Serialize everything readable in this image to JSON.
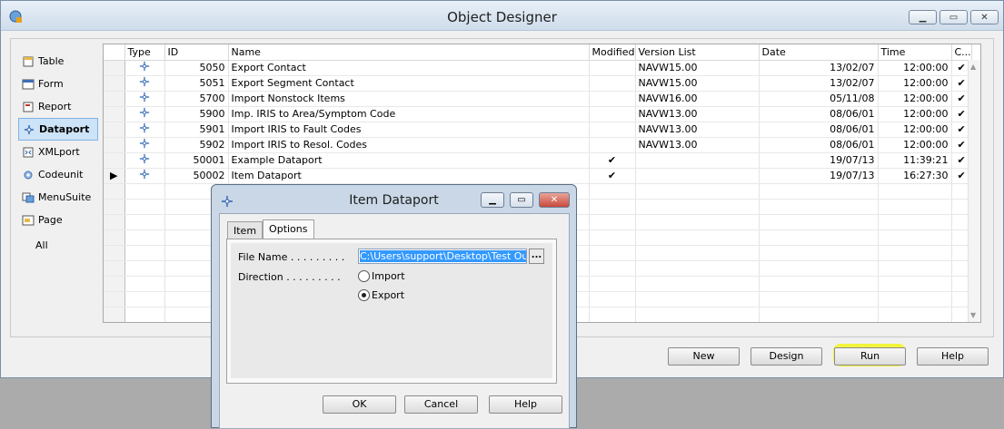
{
  "window": {
    "title": "Object Designer"
  },
  "nav": {
    "items": [
      {
        "label": "Table",
        "icon": "table-icon"
      },
      {
        "label": "Form",
        "icon": "form-icon"
      },
      {
        "label": "Report",
        "icon": "report-icon"
      },
      {
        "label": "Dataport",
        "icon": "dataport-icon"
      },
      {
        "label": "XMLport",
        "icon": "xmlport-icon"
      },
      {
        "label": "Codeunit",
        "icon": "codeunit-icon"
      },
      {
        "label": "MenuSuite",
        "icon": "menusuite-icon"
      },
      {
        "label": "Page",
        "icon": "page-icon"
      },
      {
        "label": "All",
        "icon": ""
      }
    ],
    "active": "Dataport"
  },
  "grid": {
    "headers": [
      "Type",
      "ID",
      "Name",
      "Modified",
      "Version List",
      "Date",
      "Time",
      "C..."
    ],
    "rows": [
      {
        "id": "5050",
        "name": "Export Contact",
        "modified": "",
        "version": "NAVW15.00",
        "date": "13/02/07",
        "time": "12:00:00",
        "compiled": "✔"
      },
      {
        "id": "5051",
        "name": "Export Segment Contact",
        "modified": "",
        "version": "NAVW15.00",
        "date": "13/02/07",
        "time": "12:00:00",
        "compiled": "✔"
      },
      {
        "id": "5700",
        "name": "Import Nonstock Items",
        "modified": "",
        "version": "NAVW16.00",
        "date": "05/11/08",
        "time": "12:00:00",
        "compiled": "✔"
      },
      {
        "id": "5900",
        "name": "Imp. IRIS to Area/Symptom Code",
        "modified": "",
        "version": "NAVW13.00",
        "date": "08/06/01",
        "time": "12:00:00",
        "compiled": "✔"
      },
      {
        "id": "5901",
        "name": "Import IRIS to Fault Codes",
        "modified": "",
        "version": "NAVW13.00",
        "date": "08/06/01",
        "time": "12:00:00",
        "compiled": "✔"
      },
      {
        "id": "5902",
        "name": "Import IRIS to Resol. Codes",
        "modified": "",
        "version": "NAVW13.00",
        "date": "08/06/01",
        "time": "12:00:00",
        "compiled": "✔"
      },
      {
        "id": "50001",
        "name": "Example Dataport",
        "modified": "✔",
        "version": "",
        "date": "19/07/13",
        "time": "11:39:21",
        "compiled": "✔"
      },
      {
        "id": "50002",
        "name": "Item Dataport",
        "modified": "✔",
        "version": "",
        "date": "19/07/13",
        "time": "16:27:30",
        "compiled": "✔"
      }
    ]
  },
  "buttons": {
    "new": "New",
    "design": "Design",
    "run": "Run",
    "help": "Help"
  },
  "dialog": {
    "title": "Item Dataport",
    "tabs": [
      "Item",
      "Options"
    ],
    "active_tab": "Options",
    "file_name_label": "File Name . . . . . . . . .",
    "file_name_value": "C:\\Users\\support\\Desktop\\Test Output",
    "direction_label": "Direction . . . . . . . . .",
    "direction_options": [
      "Import",
      "Export"
    ],
    "direction_selected": "Export",
    "ok": "OK",
    "cancel": "Cancel",
    "help": "Help"
  },
  "colors": {
    "highlight": "#f3f51c",
    "selection": "#3399ff",
    "active_nav": "#cde3f7"
  }
}
